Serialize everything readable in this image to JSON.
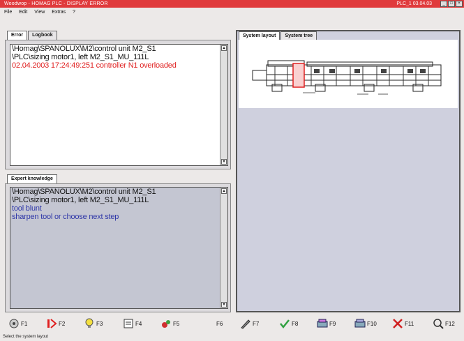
{
  "titlebar": {
    "title": "Woodwop - HOMAG PLC - DISPLAY ERROR",
    "right_info": "PLC_1  03.04.03"
  },
  "menu": [
    "File",
    "Edit",
    "View",
    "Extras",
    "?"
  ],
  "error_panel": {
    "tabs": [
      "Error",
      "Logbook"
    ],
    "lines": [
      "\\Homag\\SPANOLUX\\M2\\control unit  M2_S1",
      "\\PLC\\sizing motor1, left  M2_S1_MU_111L",
      "02.04.2003 17:24:49:251 controller N1 overloaded"
    ]
  },
  "expert_panel": {
    "tabs": [
      "Expert knowledge"
    ],
    "lines": [
      "\\Homag\\SPANOLUX\\M2\\control unit  M2_S1",
      "\\PLC\\sizing motor1, left  M2_S1_MU_111L",
      "tool blunt",
      "sharpen tool or choose next step"
    ]
  },
  "layout_panel": {
    "tabs": [
      "System layout",
      "System tree"
    ]
  },
  "function_keys": [
    {
      "label": "F1",
      "icon": "help-icon"
    },
    {
      "label": "F2",
      "icon": "error-list-icon"
    },
    {
      "label": "F3",
      "icon": "lightbulb-icon"
    },
    {
      "label": "F4",
      "icon": "document-icon"
    },
    {
      "label": "F5",
      "icon": "tools-icon"
    },
    {
      "label": "F6",
      "icon": ""
    },
    {
      "label": "F7",
      "icon": "edit-icon"
    },
    {
      "label": "F8",
      "icon": "checkmark-icon"
    },
    {
      "label": "F9",
      "icon": "machine-icon"
    },
    {
      "label": "F10",
      "icon": "machine-settings-icon"
    },
    {
      "label": "F11",
      "icon": "close-x-icon"
    },
    {
      "label": "F12",
      "icon": "magnifier-icon"
    }
  ],
  "status": "Select the system layout",
  "colors": {
    "title_bar": "#e03a3c",
    "error_text": "#e02020",
    "expert_text": "#3038a8",
    "expert_bg": "#c4c6d2"
  }
}
